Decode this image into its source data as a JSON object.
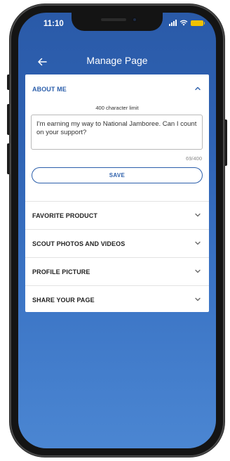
{
  "status_bar": {
    "time": "11:10"
  },
  "nav": {
    "title": "Manage Page",
    "back_icon": "arrow-left-icon"
  },
  "about_me": {
    "title": "ABOUT ME",
    "expanded": true,
    "char_limit_text": "400 character limit",
    "text_value": "I'm earning my way to National Jamboree. Can I count on your support?",
    "char_count": "69/400",
    "save_label": "SAVE"
  },
  "sections": [
    {
      "title": "FAVORITE PRODUCT"
    },
    {
      "title": "SCOUT PHOTOS AND VIDEOS"
    },
    {
      "title": "PROFILE PICTURE"
    },
    {
      "title": "SHARE YOUR PAGE"
    }
  ],
  "colors": {
    "accent": "#2c5fab",
    "background_top": "#2a5aa8",
    "background_bottom": "#4b86d2",
    "battery": "#f2c200"
  }
}
